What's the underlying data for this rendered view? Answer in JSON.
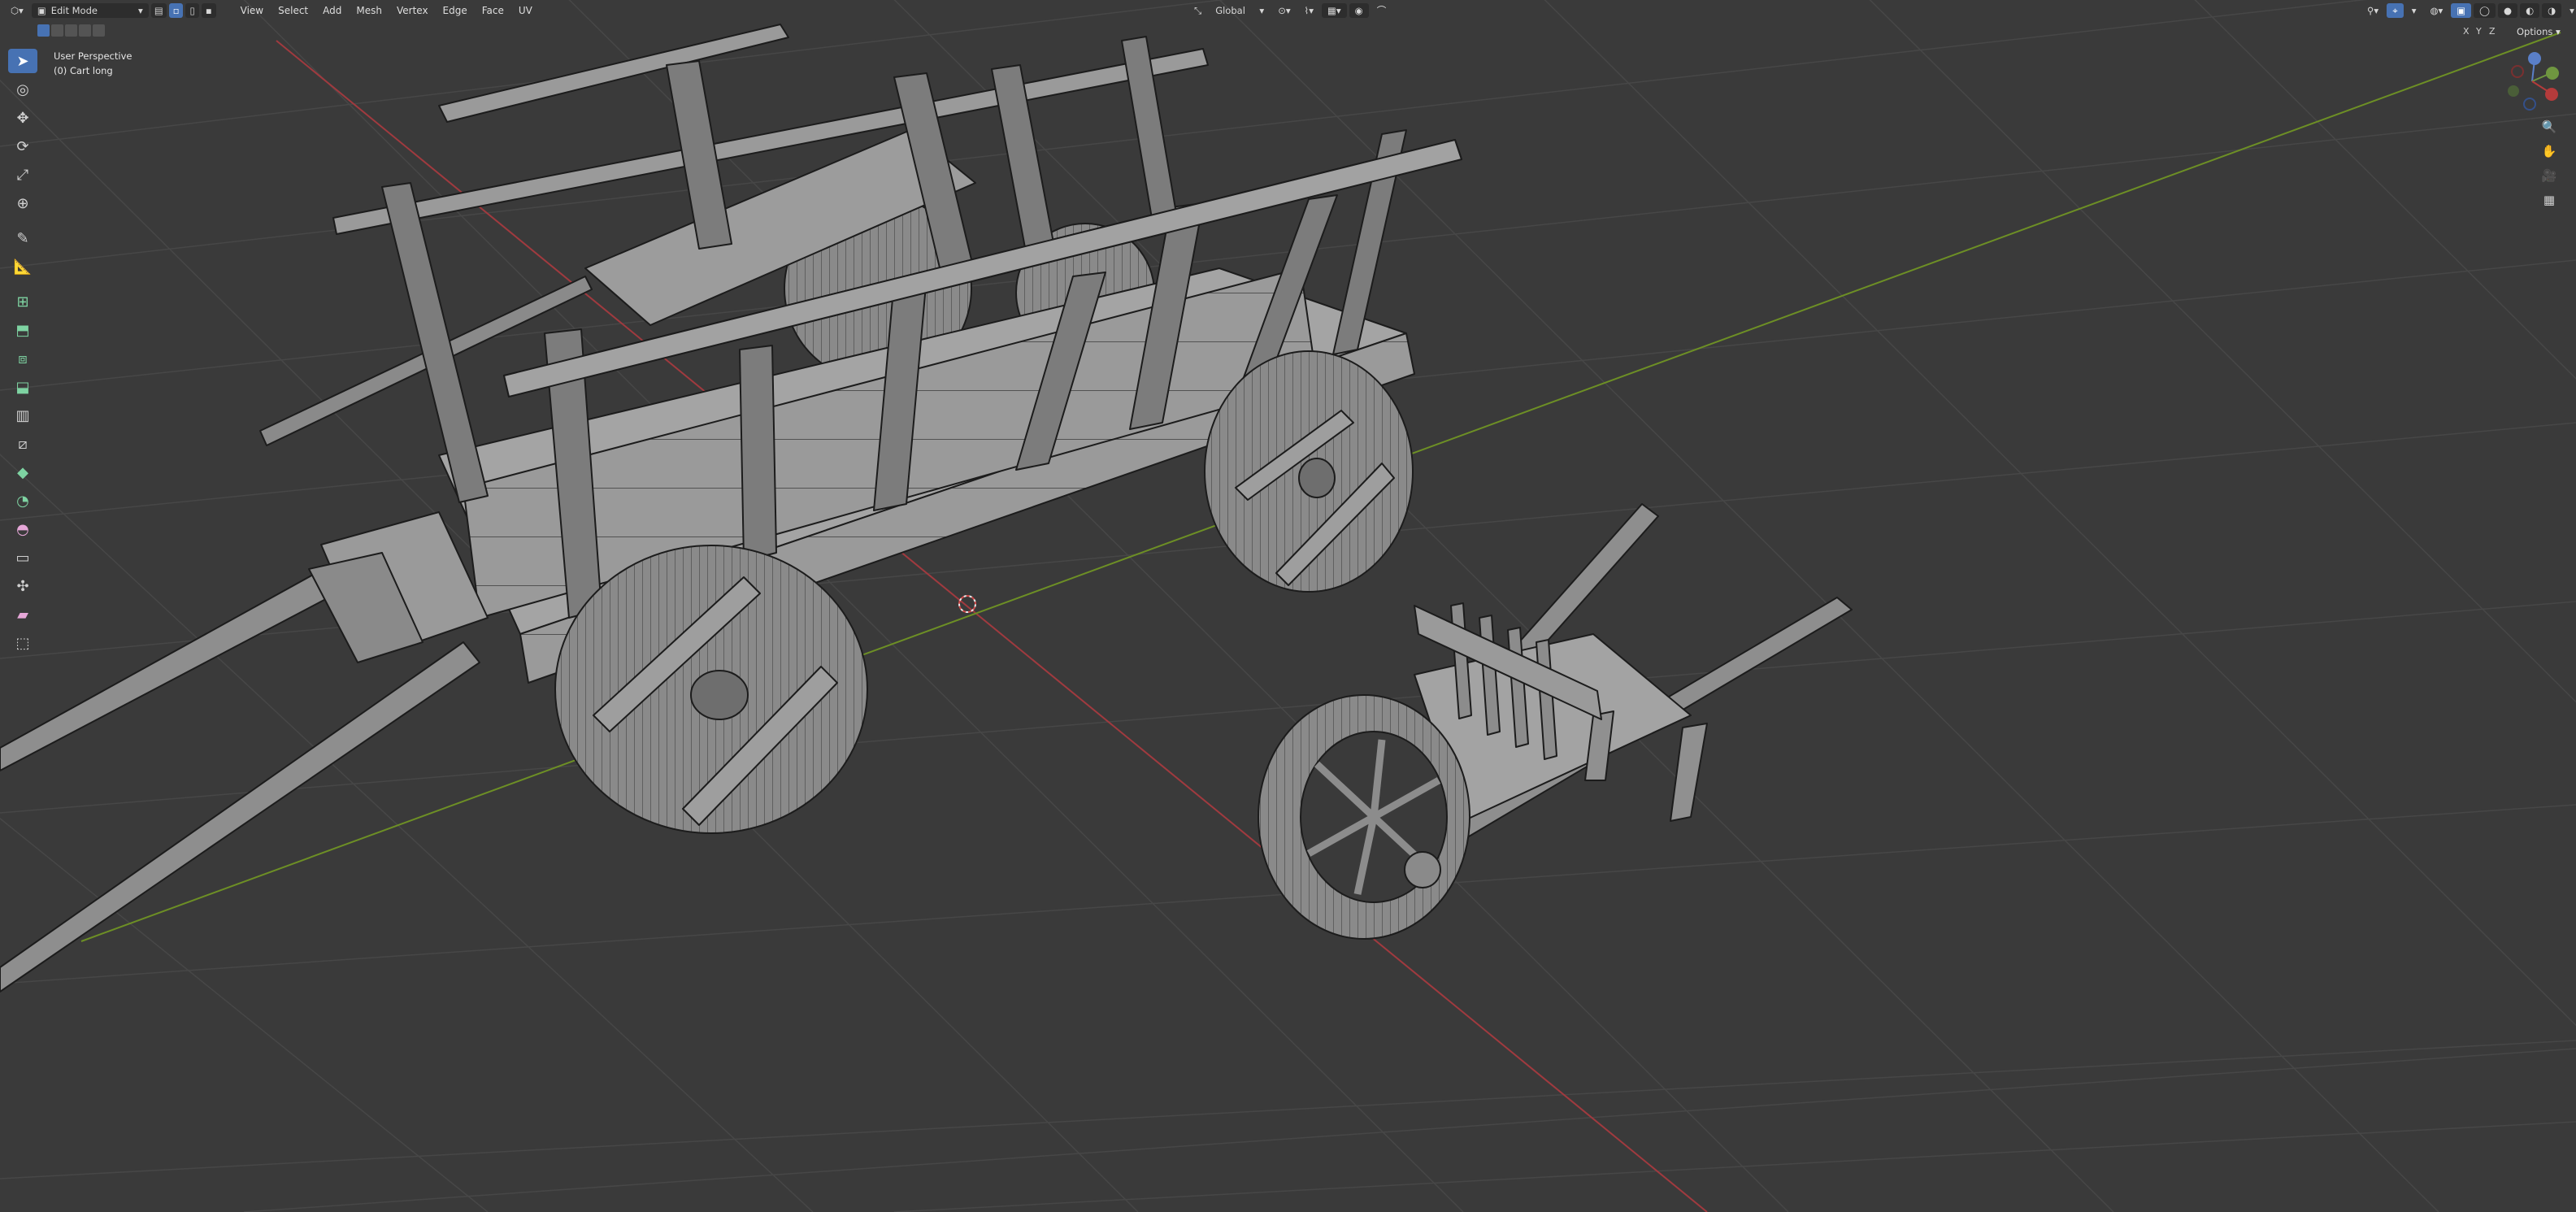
{
  "header": {
    "mode": "Edit Mode",
    "menus": [
      "View",
      "Select",
      "Add",
      "Mesh",
      "Vertex",
      "Edge",
      "Face",
      "UV"
    ],
    "orientation": "Global",
    "options_label": "Options",
    "axes": [
      "X",
      "Y",
      "Z"
    ]
  },
  "viewport": {
    "view_name": "User Perspective",
    "object_name": "(0) Cart long"
  },
  "toolbar": {
    "tools": [
      {
        "name": "select-box-tool",
        "icon": "cursor-arrow",
        "active": true
      },
      {
        "name": "cursor-tool",
        "icon": "3d-cursor"
      },
      {
        "name": "move-tool",
        "icon": "move-arrows"
      },
      {
        "name": "rotate-tool",
        "icon": "rotate"
      },
      {
        "name": "scale-tool",
        "icon": "scale"
      },
      {
        "name": "transform-tool",
        "icon": "transform"
      },
      {
        "name": "annotate-tool",
        "icon": "pencil"
      },
      {
        "name": "measure-tool",
        "icon": "ruler"
      },
      {
        "name": "add-cube-tool",
        "icon": "cube-plus"
      },
      {
        "name": "extrude-tool",
        "icon": "extrude"
      },
      {
        "name": "inset-tool",
        "icon": "inset-faces"
      },
      {
        "name": "bevel-tool",
        "icon": "bevel"
      },
      {
        "name": "loop-cut-tool",
        "icon": "loop-cut"
      },
      {
        "name": "knife-tool",
        "icon": "knife"
      },
      {
        "name": "poly-build-tool",
        "icon": "poly-build"
      },
      {
        "name": "spin-tool",
        "icon": "spin"
      },
      {
        "name": "smooth-tool",
        "icon": "smooth"
      },
      {
        "name": "edge-slide-tool",
        "icon": "edge-slide"
      },
      {
        "name": "shrink-fatten-tool",
        "icon": "shrink-fatten"
      },
      {
        "name": "shear-tool",
        "icon": "shear"
      },
      {
        "name": "rip-region-tool",
        "icon": "rip-region"
      }
    ]
  },
  "colors": {
    "background": "#3a3a3a",
    "grid": "#474747",
    "x_axis": "#a03a3f",
    "y_axis": "#6d8f25",
    "mesh_face": "#8b8b8b",
    "mesh_dark": "#5c5c5c",
    "wire": "#1a1a1a",
    "accent": "#4772b3"
  }
}
